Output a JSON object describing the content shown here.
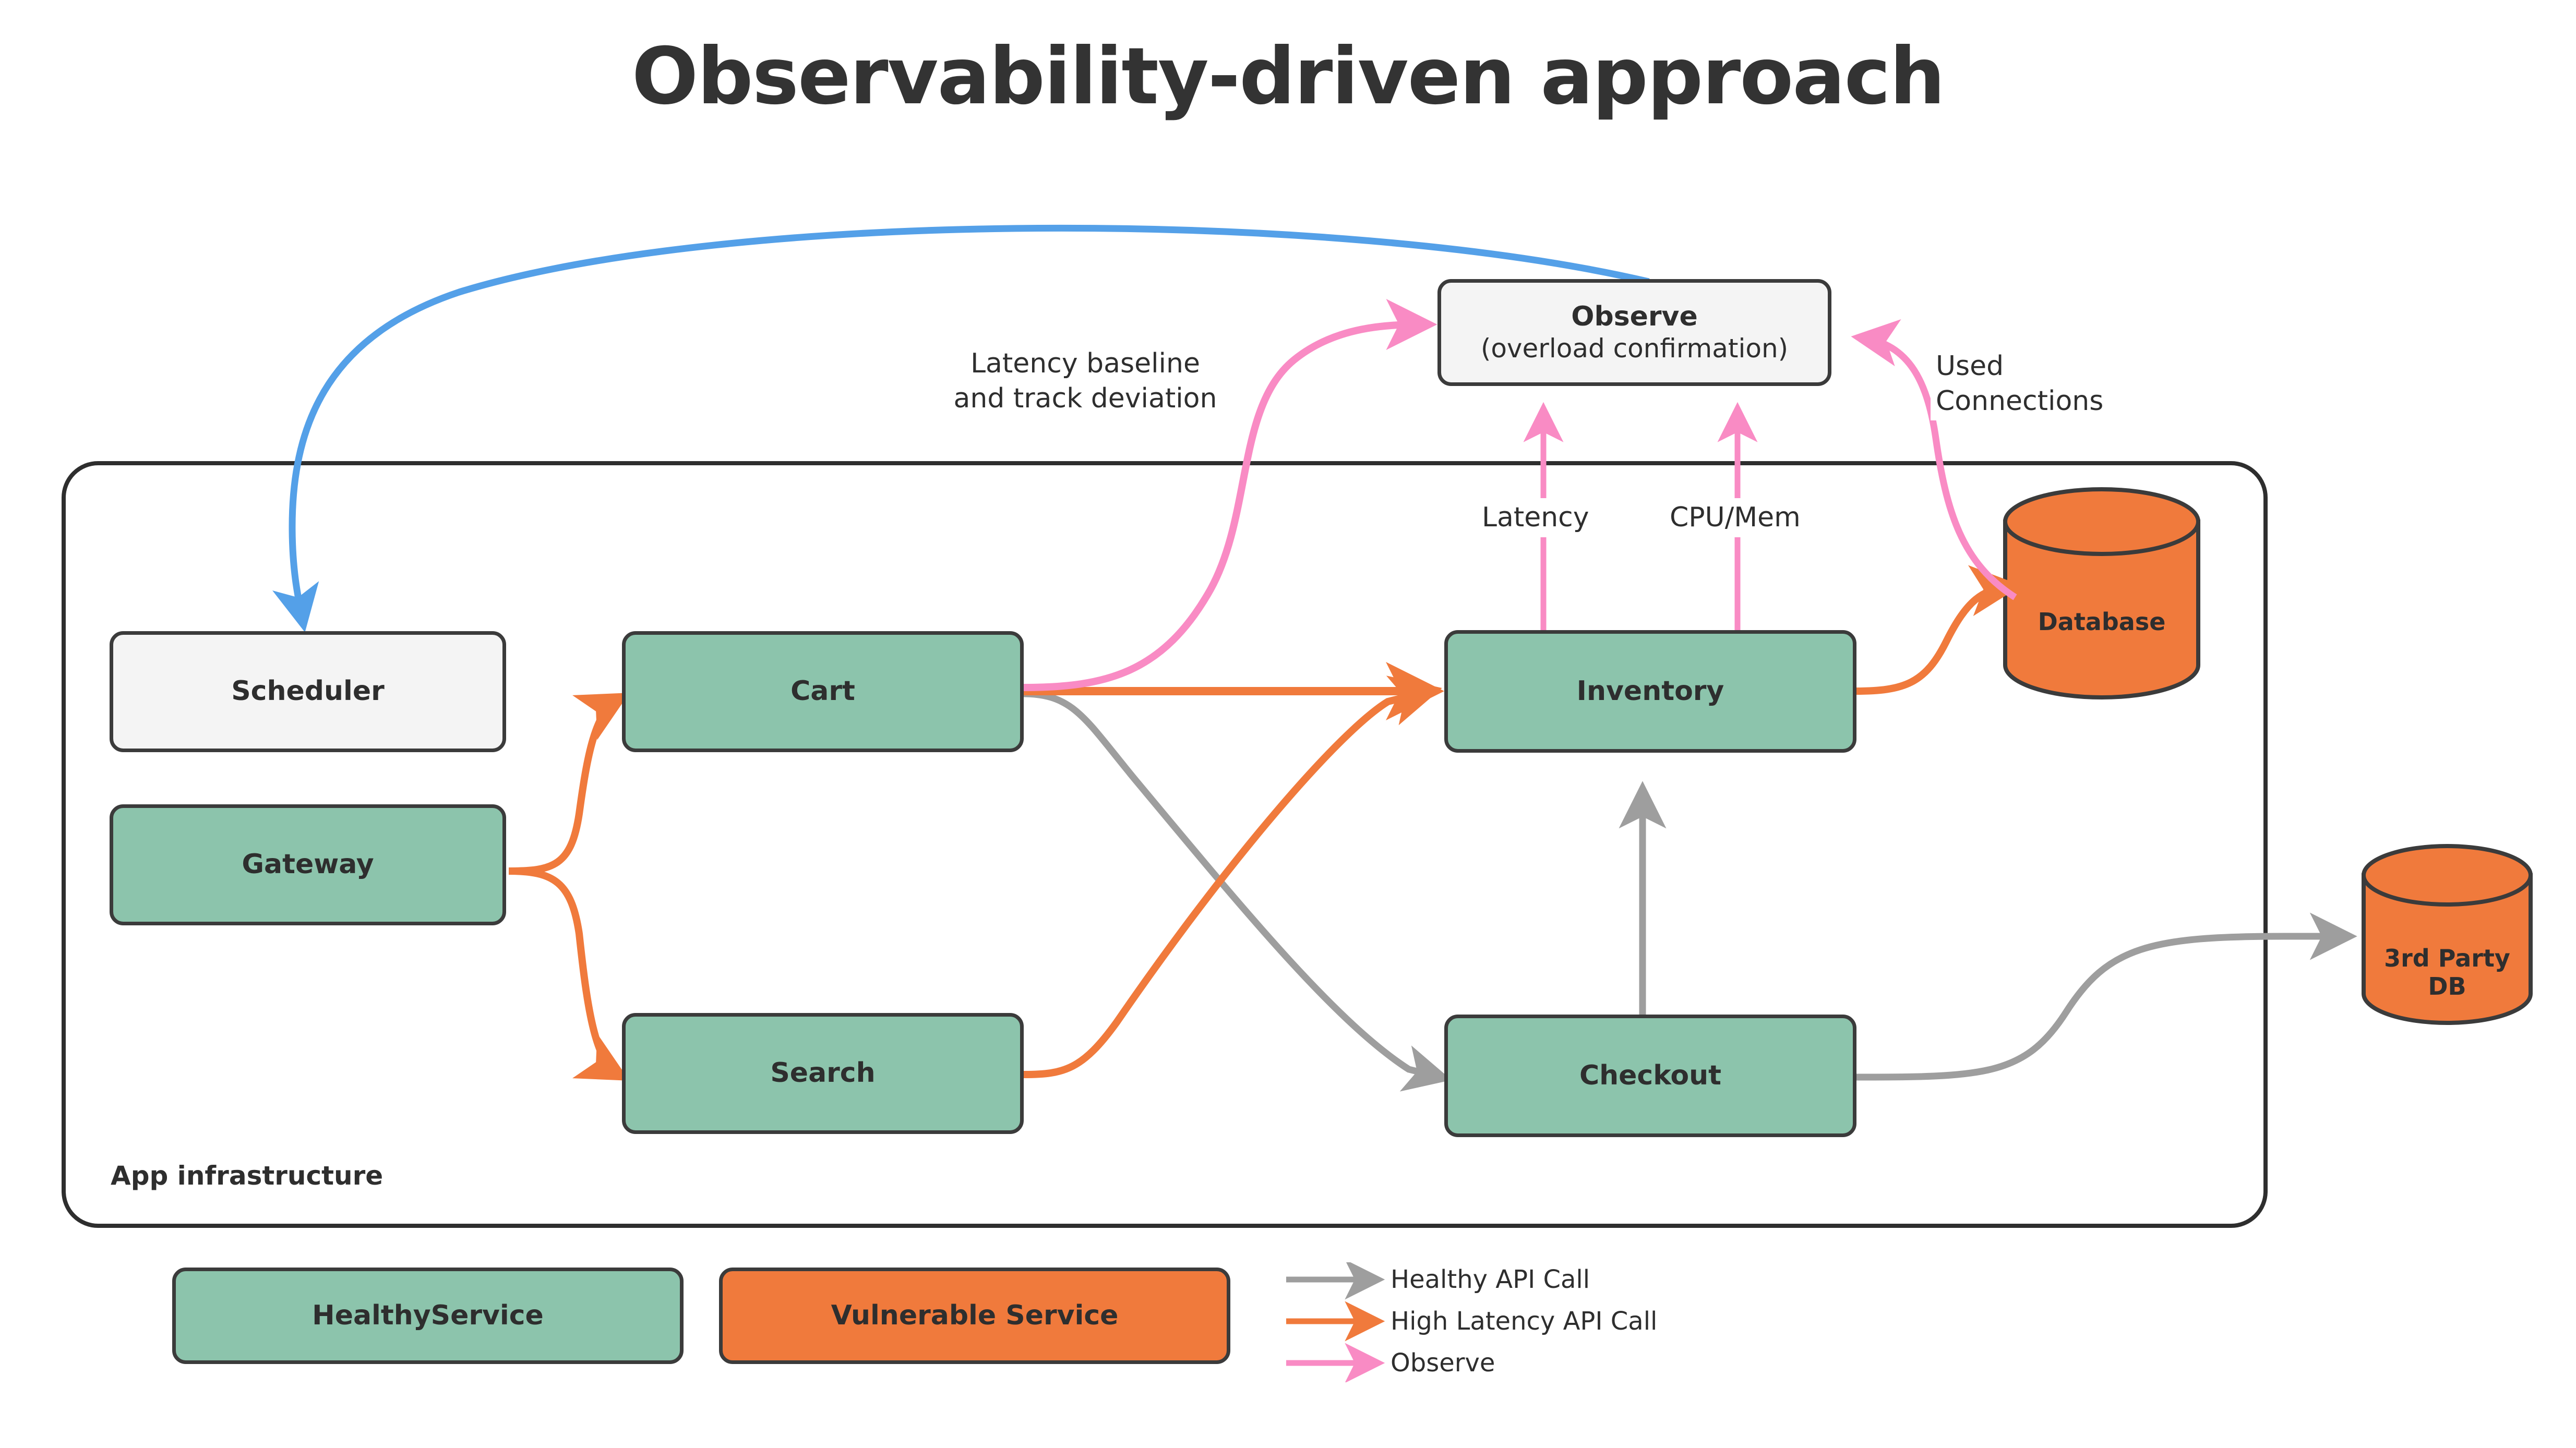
{
  "title": "Observability-driven approach",
  "container": {
    "label": "App infrastructure"
  },
  "nodes": {
    "observe": {
      "label": "Observe",
      "sub": "(overload confirmation)"
    },
    "scheduler": {
      "label": "Scheduler"
    },
    "gateway": {
      "label": "Gateway"
    },
    "cart": {
      "label": "Cart"
    },
    "search": {
      "label": "Search"
    },
    "inventory": {
      "label": "Inventory"
    },
    "checkout": {
      "label": "Checkout"
    },
    "database": {
      "label": "Database"
    },
    "thirdparty": {
      "label": "3rd Party DB"
    }
  },
  "edge_labels": {
    "latency_baseline": "Latency baseline\nand track deviation",
    "latency_baseline_line1": "Latency baseline",
    "latency_baseline_line2": "and track deviation",
    "used_connections_line1": "Used",
    "used_connections_line2": "Connections",
    "latency": "Latency",
    "cpu_mem": "CPU/Mem"
  },
  "legend": {
    "chips": [
      {
        "label": "HealthyService",
        "color": "#8cc4ac"
      },
      {
        "label": "Vulnerable Service",
        "color": "#f07a3c"
      }
    ],
    "keys": [
      {
        "label": "Healthy API Call",
        "color": "#9e9e9e"
      },
      {
        "label": "High Latency API Call",
        "color": "#f07a3c"
      },
      {
        "label": "Observe",
        "color": "#f98bc4"
      }
    ]
  },
  "colors": {
    "green": "#8cc4ac",
    "orange": "#f07a3c",
    "grey_node": "#f4f4f4",
    "stroke": "#3b3b3b",
    "healthy_edge": "#9e9e9e",
    "latency_edge": "#f07a3c",
    "observe_edge": "#f98bc4",
    "blue_edge": "#54a0e8",
    "text": "#2e2e2e"
  }
}
